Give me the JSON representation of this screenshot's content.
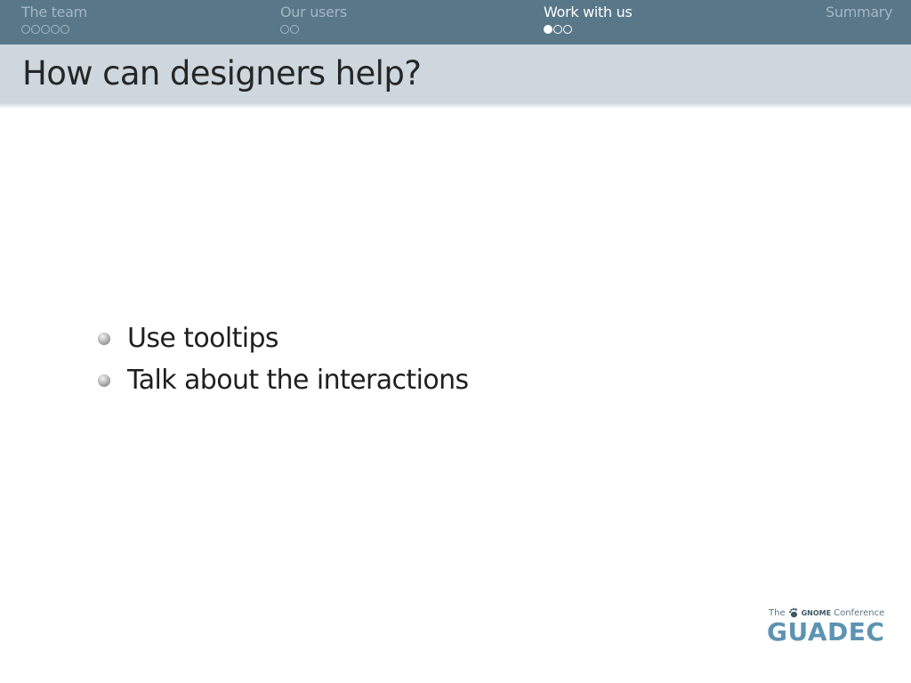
{
  "nav": {
    "sections": [
      {
        "label": "The team",
        "dots": 5,
        "current": -1
      },
      {
        "label": "Our users",
        "dots": 2,
        "current": -1
      },
      {
        "label": "Work with us",
        "dots": 3,
        "current": 0
      },
      {
        "label": "Summary",
        "dots": 0,
        "current": -1
      }
    ],
    "active_section": "Work with us"
  },
  "frame": {
    "title": "How can designers help?",
    "bullets": [
      "Use tooltips",
      "Talk about the interactions"
    ]
  },
  "logo": {
    "prefix": "The",
    "brand": "GNOME",
    "suffix": "Conference",
    "word": "GUADEC",
    "icon": "gnome-foot-icon"
  },
  "colors": {
    "nav_background": "#587789",
    "title_band_background": "#cdd7dd",
    "logo_blue": "#5d93b2"
  }
}
